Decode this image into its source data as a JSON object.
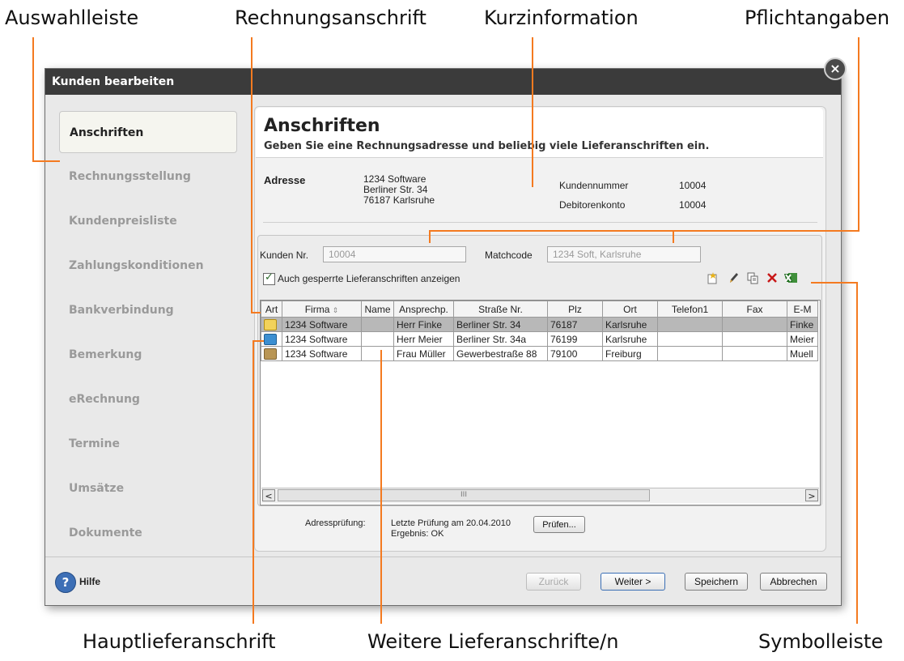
{
  "callouts": {
    "auswahlleiste": "Auswahlleiste",
    "rechnungsanschrift": "Rechnungsanschrift",
    "kurzinformation": "Kurzinformation",
    "pflichtangaben": "Pflichtangaben",
    "hauptlieferanschrift": "Hauptlieferanschrift",
    "weitere": "Weitere Lieferanschrifte/n",
    "symbolleiste": "Symbolleiste"
  },
  "window": {
    "title": "Kunden bearbeiten",
    "close_glyph": "×"
  },
  "sidebar": {
    "items": [
      {
        "label": "Anschriften"
      },
      {
        "label": "Rechnungsstellung"
      },
      {
        "label": "Kundenpreisliste"
      },
      {
        "label": "Zahlungskonditionen"
      },
      {
        "label": "Bankverbindung"
      },
      {
        "label": "Bemerkung"
      },
      {
        "label": "eRechnung"
      },
      {
        "label": "Termine"
      },
      {
        "label": "Umsätze"
      },
      {
        "label": "Dokumente"
      }
    ]
  },
  "header": {
    "title": "Anschriften",
    "subtitle": "Geben Sie eine Rechnungsadresse und beliebig viele Lieferanschriften ein."
  },
  "summary": {
    "address_label": "Adresse",
    "address_lines": [
      "1234 Software",
      "Berliner Str. 34",
      "76187 Karlsruhe"
    ],
    "kundennummer_label": "Kundennummer",
    "kundennummer_value": "10004",
    "debitorenkonto_label": "Debitorenkonto",
    "debitorenkonto_value": "10004"
  },
  "form": {
    "kunden_nr_label": "Kunden Nr.",
    "kunden_nr_value": "10004",
    "matchcode_label": "Matchcode",
    "matchcode_value": "1234 Soft, Karlsruhe",
    "checkbox_label": "Auch gesperrte  Lieferanschriften anzeigen",
    "checkbox_checked": true
  },
  "toolbar": {
    "icons": [
      "new-icon",
      "edit-icon",
      "copy-icon",
      "delete-icon",
      "excel-icon"
    ]
  },
  "table": {
    "columns": [
      "Art",
      "Firma",
      "Name",
      "Ansprechp.",
      "Straße Nr.",
      "Plz",
      "Ort",
      "Telefon1",
      "Fax",
      "E-M"
    ],
    "rows": [
      {
        "art_icon": "envelope-icon",
        "cells": [
          "1234 Software",
          "",
          "Herr Finke",
          "Berliner Str. 34",
          "76187",
          "Karlsruhe",
          "",
          "",
          "Finke"
        ]
      },
      {
        "art_icon": "delivery-box-icon",
        "cells": [
          "1234 Software",
          "",
          "Herr Meier",
          "Berliner Str. 34a",
          "76199",
          "Karlsruhe",
          "",
          "",
          "Meier"
        ]
      },
      {
        "art_icon": "package-icon",
        "cells": [
          "1234 Software",
          "",
          "Frau Müller",
          "Gewerbestraße  88",
          "79100",
          "Freiburg",
          "",
          "",
          "Muell"
        ]
      }
    ]
  },
  "scrollbar": {
    "left_arrow": "<",
    "right_arrow": ">",
    "thumb_grip": "III"
  },
  "check": {
    "label": "Adressprüfung:",
    "result_line1": "Letzte Prüfung am 20.04.2010",
    "result_line2": "Ergebnis: OK",
    "button": "Prüfen..."
  },
  "footer": {
    "help_glyph": "?",
    "help": "Hilfe",
    "back": "Zurück",
    "next": "Weiter >",
    "save": "Speichern",
    "cancel": "Abbrechen"
  },
  "colors": {
    "callout_line": "#f47a20",
    "titlebar": "#3b3b3b",
    "selected_row": "#b8b8b8"
  }
}
